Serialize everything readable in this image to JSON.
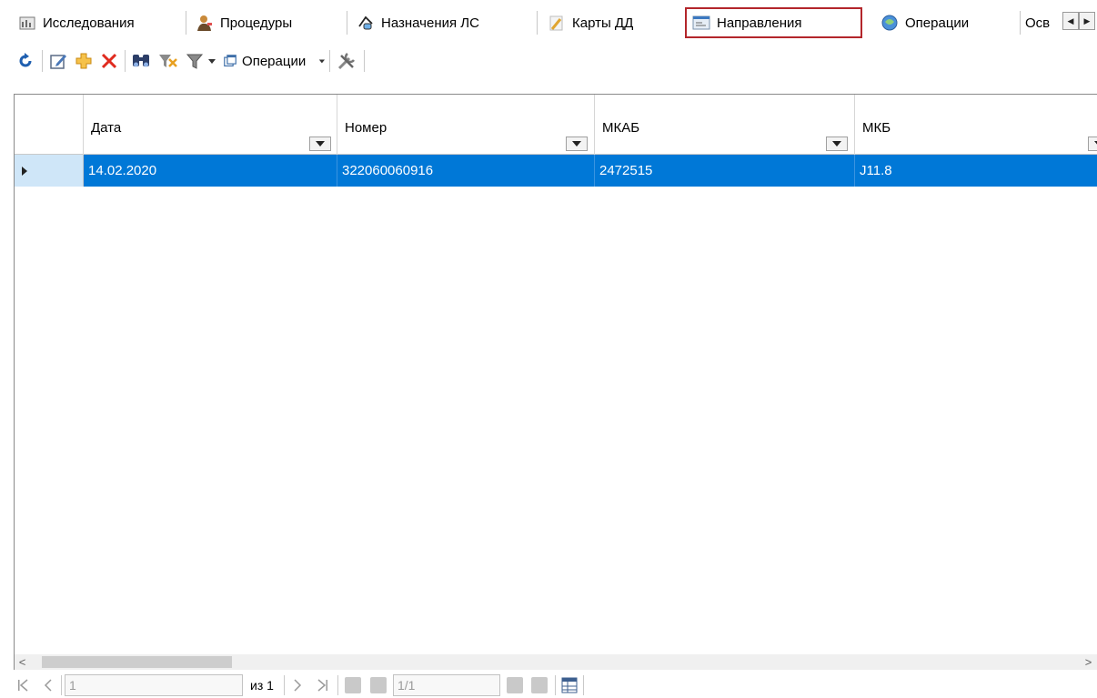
{
  "tabs": [
    {
      "label": "Исследования",
      "icon": "research-icon"
    },
    {
      "label": "Процедуры",
      "icon": "procedure-icon"
    },
    {
      "label": "Назначения ЛС",
      "icon": "prescription-icon"
    },
    {
      "label": "Карты ДД",
      "icon": "card-icon"
    },
    {
      "label": "Направления",
      "icon": "referral-icon",
      "active": true
    },
    {
      "label": "Операции",
      "icon": "operation-icon"
    },
    {
      "label": "Осв",
      "icon": ""
    }
  ],
  "toolbar": {
    "operations_label": "Операции",
    "icons": [
      "refresh-icon",
      "edit-icon",
      "add-icon",
      "delete-icon",
      "find-icon",
      "clear-filter-icon",
      "filter-icon",
      "operations-icon",
      "tools-icon"
    ]
  },
  "grid": {
    "columns": [
      {
        "label": "Дата"
      },
      {
        "label": "Номер"
      },
      {
        "label": "МКАБ"
      },
      {
        "label": "МКБ"
      }
    ],
    "rows": [
      {
        "date": "14.02.2020",
        "number": "322060060916",
        "mkab": "2472515",
        "mkb": "J11.8",
        "selected": true
      }
    ]
  },
  "navigator": {
    "position": "1",
    "of_label": "из 1",
    "record": "1/1"
  },
  "colors": {
    "selection": "#0078d7",
    "active_tab_border": "#b3262b",
    "row_header": "#cfe6f8"
  }
}
